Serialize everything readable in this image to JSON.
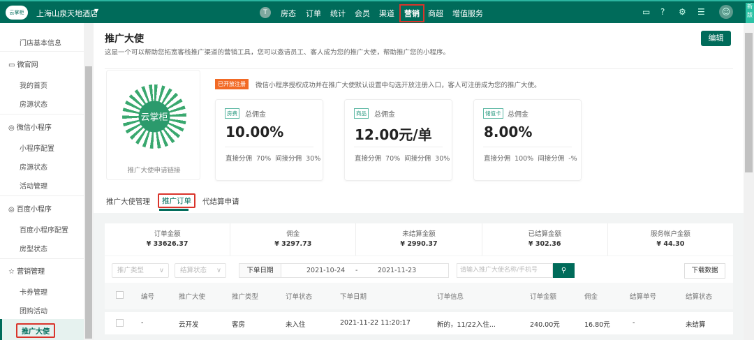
{
  "topbar": {
    "logo": "云掌柜",
    "hotel": "上海山泉天地酒店",
    "nav": [
      "房态",
      "订单",
      "统计",
      "会员",
      "渠道",
      "营销",
      "商超",
      "增值服务"
    ],
    "active_nav": "营销",
    "new_tag": "新版"
  },
  "sidebar": {
    "partial_top": "门店基本信息",
    "groups": [
      {
        "label": "微官网",
        "icon": "monitor-icon",
        "items": [
          "我的首页",
          "房源状态"
        ]
      },
      {
        "label": "微信小程序",
        "icon": "compass-icon",
        "items": [
          "小程序配置",
          "房源状态",
          "活动管理"
        ]
      },
      {
        "label": "百度小程序",
        "icon": "compass-icon",
        "items": [
          "百度小程序配置",
          "房型状态"
        ]
      },
      {
        "label": "营销管理",
        "icon": "marketing-icon",
        "items": [
          "卡券管理",
          "团购活动",
          "推广大使"
        ]
      }
    ],
    "active_item": "推广大使"
  },
  "page": {
    "title": "推广大使",
    "description": "这是一个可以帮助您拓宽客栈推广渠道的营销工具，您可以邀请员工、客人成为您的推广大使，帮助推广您的小程序。",
    "edit": "编辑",
    "qr_logo": "云掌柜",
    "qr_caption": "推广大使申请链接",
    "notice_tag": "已开放注册",
    "notice": "微信小程序授权成功并在推广大使默认设置中勾选开放注册入口，客人可注册成为您的推广大使。",
    "cards": [
      {
        "tag": "房费",
        "label": "总佣金",
        "value": "10.00%",
        "split": "直接分佣 70% 间接分佣 30%"
      },
      {
        "tag": "商品",
        "label": "总佣金",
        "value": "12.00元/单",
        "split": "直接分佣 70% 间接分佣 30%"
      },
      {
        "tag": "储值卡",
        "label": "总佣金",
        "value": "8.00%",
        "split": "直接分佣 100% 间接分佣 -%"
      }
    ],
    "tabs": [
      "推广大使管理",
      "推广订单",
      "代结算申请"
    ],
    "active_tab": "推广订单"
  },
  "stats": [
    {
      "k": "订单金额",
      "v": "¥ 33626.37"
    },
    {
      "k": "佣金",
      "v": "¥ 3297.73"
    },
    {
      "k": "未结算金额",
      "v": "¥ 2990.37"
    },
    {
      "k": "已结算金额",
      "v": "¥ 302.36"
    },
    {
      "k": "服务帐户金额",
      "v": "¥ 44.30"
    }
  ],
  "filters": {
    "type": "推广类型",
    "settle": "结算状态",
    "date_label": "下单日期",
    "start": "2021-10-24",
    "sep": "-",
    "end": "2021-11-23",
    "search_placeholder": "请输入推广大使名称/手机号",
    "download": "下载数据"
  },
  "table": {
    "headers": [
      "编号",
      "推广大使",
      "推广类型",
      "订单状态",
      "下单日期",
      "订单信息",
      "订单金额",
      "佣金",
      "结算单号",
      "结算状态"
    ],
    "rows": [
      [
        "-",
        "云开发",
        "客房",
        "未入住",
        "2021-11-22 11:20:17",
        "新的，11/22入住...",
        "240.00元",
        "16.80元",
        "-",
        "未结算"
      ]
    ]
  },
  "colors": {
    "brand": "#006b5a",
    "notice": "#f26a25",
    "highlight": "#d9342b"
  }
}
